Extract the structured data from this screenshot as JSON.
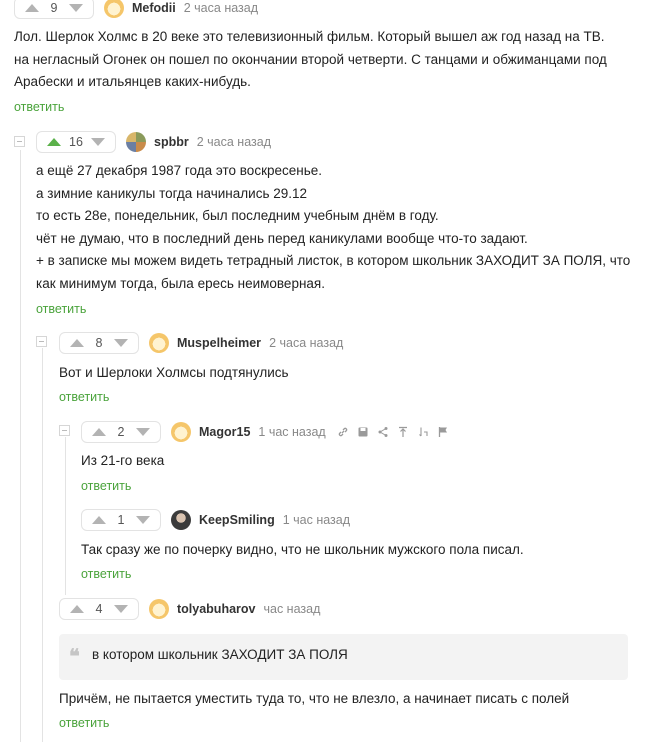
{
  "reply_label": "ответить",
  "colors": {
    "accent_green": "#4aa33b",
    "upvote_active": "#5bb14a",
    "vote_gray": "#b3b3b3"
  },
  "comments": [
    {
      "score": "9",
      "author": "Mefodii",
      "time": "2 часа назад",
      "lines": [
        "Лол. Шерлок Холмс в 20 веке это телевизионный фильм. Который вышел аж год назад на ТВ.",
        "на негласный Огонек он пошел по окончании второй четверти. С танцами и обжиманцами под",
        "Арабески и итальянцев каких-нибудь."
      ]
    },
    {
      "score": "16",
      "upvoted": true,
      "author": "spbbr",
      "time": "2 часа назад",
      "lines": [
        "а ещё 27 декабря 1987 года это воскресенье.",
        "а зимние каникулы тогда начинались 29.12",
        "то есть 28е, понедельник, был последним учебным днём в году.",
        "чёт не думаю, что в последний день перед каникулами вообще что-то задают.",
        "+ в записке мы можем видеть тетрадный листок, в котором школьник ЗАХОДИТ ЗА ПОЛЯ, что",
        "как минимум тогда, была ересь неимоверная."
      ]
    },
    {
      "score": "8",
      "author": "Muspelheimer",
      "time": "2 часа назад",
      "lines": [
        "Вот и Шерлоки Холмсы подтянулись"
      ]
    },
    {
      "score": "2",
      "author": "Magor15",
      "time": "1 час назад",
      "tools": [
        "link-icon",
        "save-icon",
        "share-icon",
        "pin-icon",
        "sort-icon",
        "flag-icon"
      ],
      "lines": [
        "Из 21-го века"
      ]
    },
    {
      "score": "1",
      "author": "KeepSmiling",
      "time": "1 час назад",
      "lines": [
        "Так сразу же по почерку видно, что не школьник мужского пола писал."
      ]
    },
    {
      "score": "4",
      "author": "tolyabuharov",
      "time": "час назад",
      "quote": "в котором школьник ЗАХОДИТ ЗА ПОЛЯ",
      "lines": [
        "Причём, не пытается уместить туда то, что не влезло, а начинает писать с полей"
      ]
    }
  ]
}
